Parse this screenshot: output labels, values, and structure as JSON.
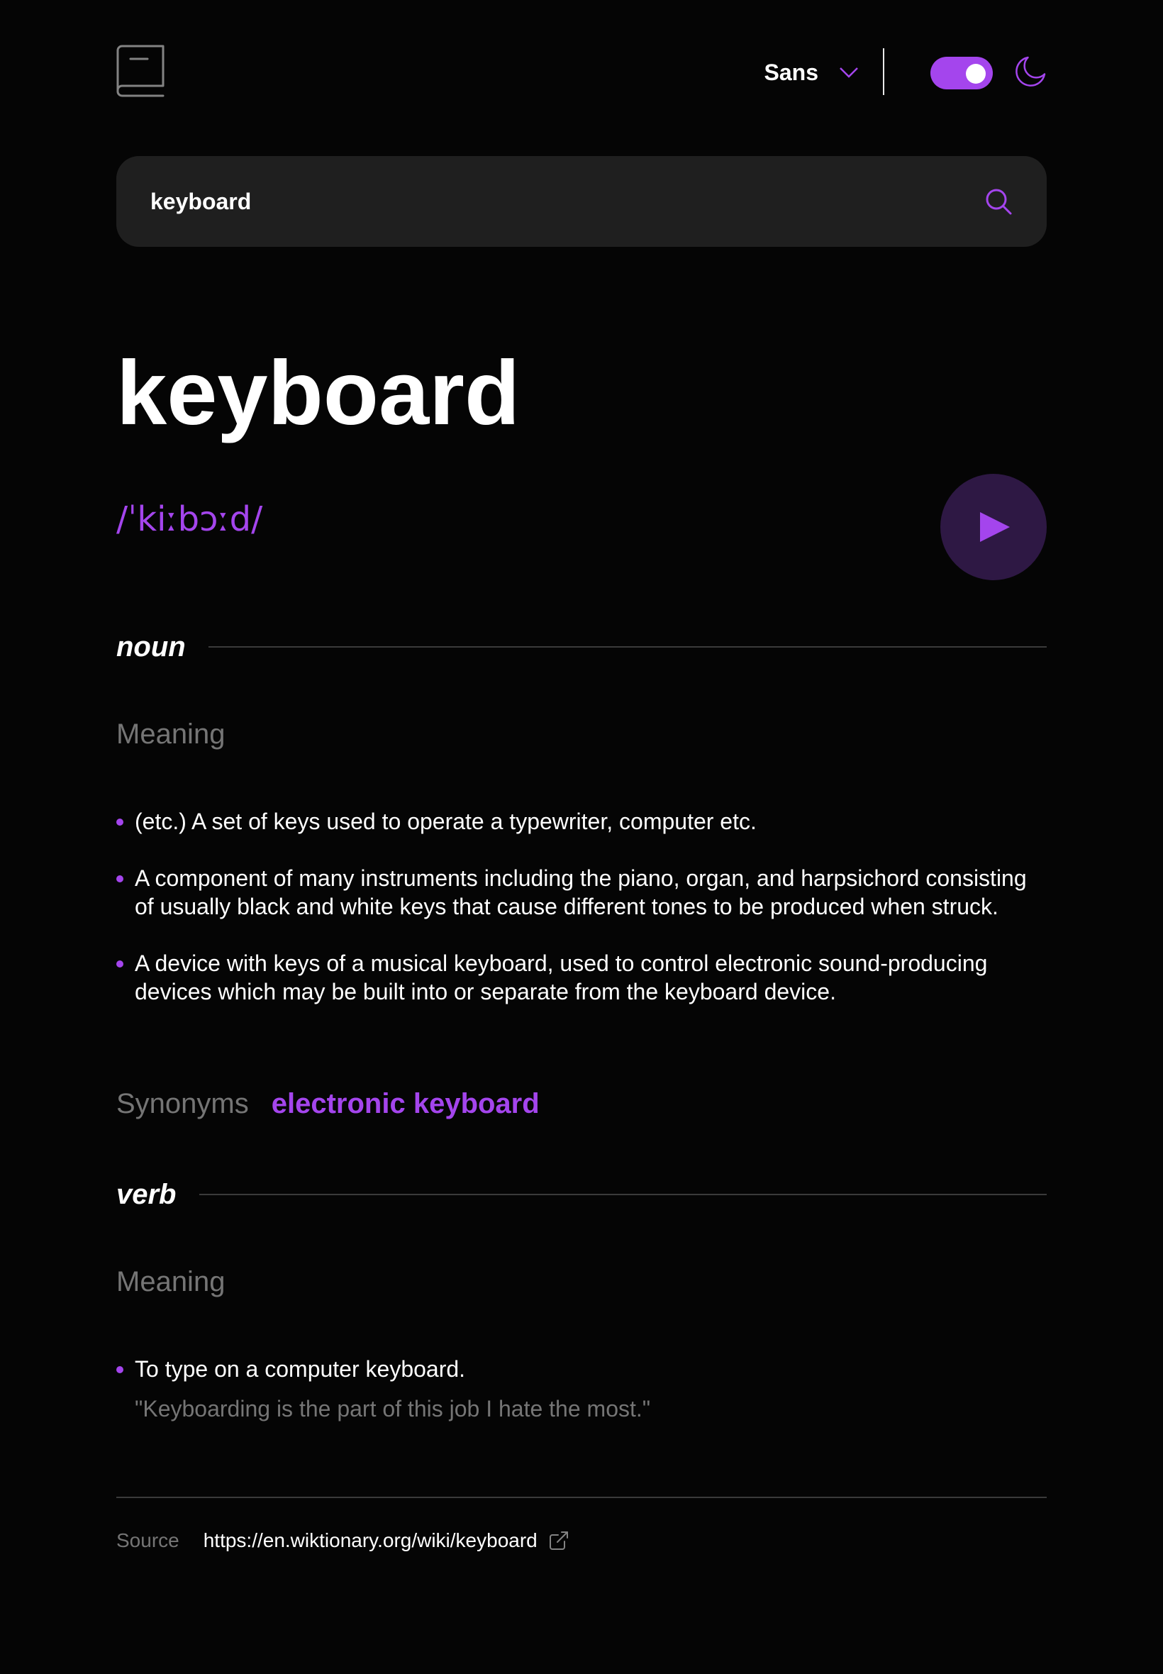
{
  "header": {
    "font_label": "Sans",
    "icons": {
      "logo": "book-icon",
      "font_dropdown": "chevron-down-icon",
      "theme": "moon-icon"
    },
    "theme_toggle_on": true
  },
  "search": {
    "value": "keyboard",
    "icon": "search-icon"
  },
  "entry": {
    "word": "keyboard",
    "phonetic": "/ˈkiːbɔːd/",
    "play_icon": "play-icon"
  },
  "noun": {
    "part_of_speech": "noun",
    "meaning_title": "Meaning",
    "definitions": [
      "(etc.) A set of keys used to operate a typewriter, computer etc.",
      "A component of many instruments including the piano, organ, and harpsichord consisting of usually black and white keys that cause different tones to be produced when struck.",
      "A device with keys of a musical keyboard, used to control electronic sound-producing devices which may be built into or separate from the keyboard device."
    ],
    "synonyms_label": "Synonyms",
    "synonyms": [
      "electronic keyboard"
    ]
  },
  "verb": {
    "part_of_speech": "verb",
    "meaning_title": "Meaning",
    "definitions": [
      {
        "definition": "To type on a computer keyboard.",
        "example": "\"Keyboarding is the part of this job I hate the most.\""
      }
    ]
  },
  "footer": {
    "source_label": "Source",
    "source_url": "https://en.wiktionary.org/wiki/keyboard",
    "link_icon": "external-link-icon"
  },
  "colors": {
    "background": "#050505",
    "accent": "#a445ed",
    "muted": "#757575",
    "surface": "#1f1f1f",
    "play_bg": "#2e1844"
  }
}
